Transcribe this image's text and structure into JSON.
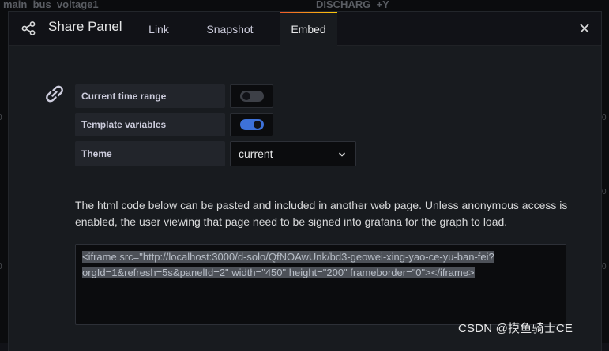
{
  "background": {
    "panel_left_title": "main_bus_voltage1",
    "panel_right_title": "DISCHARG_+Y",
    "ticks": [
      "0",
      "0",
      "0",
      "0",
      "0"
    ]
  },
  "header": {
    "title": "Share Panel",
    "tabs": [
      {
        "label": "Link",
        "active": false
      },
      {
        "label": "Snapshot",
        "active": false
      },
      {
        "label": "Embed",
        "active": true
      }
    ]
  },
  "options": {
    "current_time_range": {
      "label": "Current time range",
      "enabled": false
    },
    "template_variables": {
      "label": "Template variables",
      "enabled": true
    },
    "theme": {
      "label": "Theme",
      "value": "current"
    }
  },
  "info_text": "The html code below can be pasted and included in another web page. Unless anonymous access is enabled, the user viewing that page need to be signed into grafana for the graph to load.",
  "embed_code": "<iframe src=\"http://localhost:3000/d-solo/QfNOAwUnk/bd3-geowei-xing-yao-ce-yu-ban-fei?orgId=1&refresh=5s&panelId=2\" width=\"450\" height=\"200\" frameborder=\"0\"></iframe>",
  "watermark": "CSDN @摸鱼骑士CE",
  "colors": {
    "accent_blue": "#3d71d9",
    "tab_gradient_start": "#f05a28",
    "tab_gradient_end": "#fbca0a",
    "modal_bg": "#181b1f"
  },
  "icons": {
    "share": "share-icon",
    "close": "close-icon",
    "link": "link-icon",
    "chevron": "chevron-down-icon"
  }
}
